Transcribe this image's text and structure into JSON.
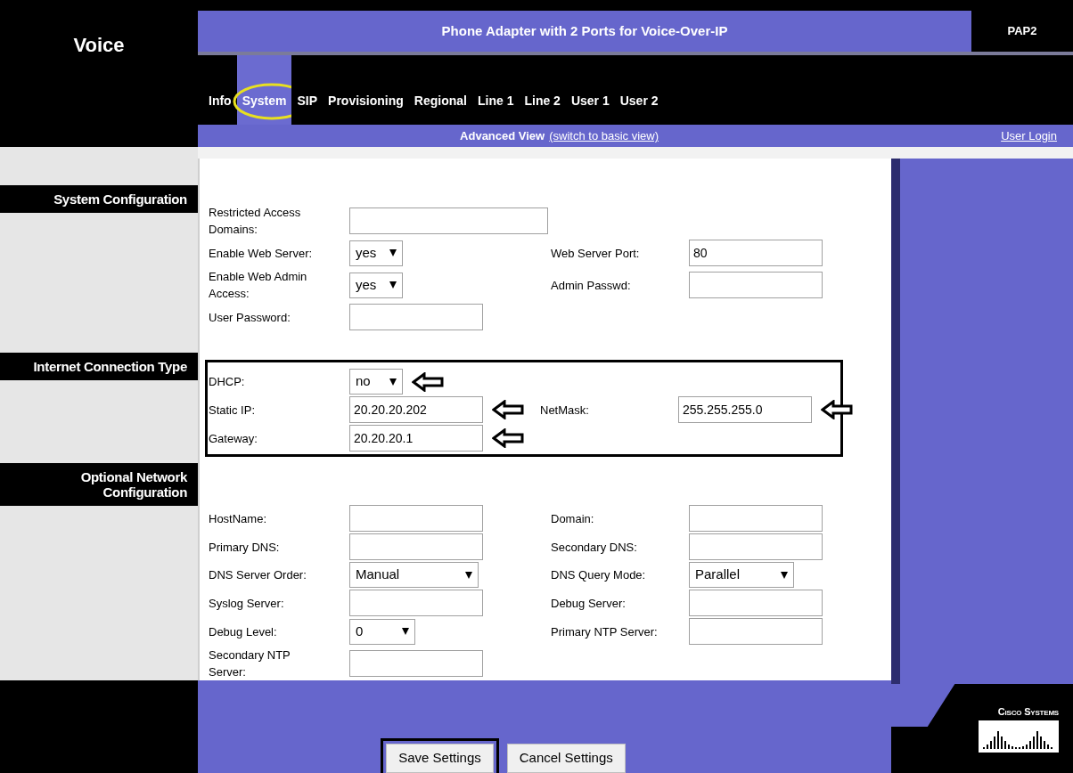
{
  "header": {
    "section": "Voice",
    "title": "Phone Adapter with 2 Ports for Voice-Over-IP",
    "model": "PAP2"
  },
  "tabs": [
    {
      "label": "Info",
      "selected": false,
      "circled": false
    },
    {
      "label": "System",
      "selected": true,
      "circled": true
    },
    {
      "label": "SIP",
      "selected": false,
      "circled": false
    },
    {
      "label": "Provisioning",
      "selected": false,
      "circled": false
    },
    {
      "label": "Regional",
      "selected": false,
      "circled": false
    },
    {
      "label": "Line 1",
      "selected": false,
      "circled": false
    },
    {
      "label": "Line 2",
      "selected": false,
      "circled": false
    },
    {
      "label": "User 1",
      "selected": false,
      "circled": false
    },
    {
      "label": "User 2",
      "selected": false,
      "circled": false
    }
  ],
  "view_bar": {
    "current": "Advanced View",
    "switch_link": "(switch to basic view)",
    "login_link": "User Login"
  },
  "sections": [
    {
      "title": "System Configuration",
      "outlined": false,
      "rows": [
        [
          {
            "label": "Restricted Access Domains:",
            "kind": "wide_text",
            "arrow": false
          }
        ],
        [
          {
            "label": "Enable Web Server:",
            "kind": "select",
            "value": "yes",
            "arrow": false
          },
          {
            "label": "Web Server Port:",
            "kind": "text",
            "value": "80",
            "arrow": false
          }
        ],
        [
          {
            "label": "Enable Web Admin Access:",
            "kind": "select",
            "value": "yes",
            "arrow": false
          },
          {
            "label": "Admin Passwd:",
            "kind": "text",
            "arrow": false
          }
        ],
        [
          {
            "label": "User Password:",
            "kind": "text",
            "arrow": false
          }
        ]
      ]
    },
    {
      "title": "Internet Connection Type",
      "outlined": true,
      "rows": [
        [
          {
            "label": "DHCP:",
            "kind": "select",
            "value": "no",
            "arrow": true
          }
        ],
        [
          {
            "label": "Static IP:",
            "kind": "text",
            "value": "20.20.20.202",
            "arrow": true
          },
          {
            "label": "NetMask:",
            "kind": "text",
            "value": "255.255.255.0",
            "arrow": true
          }
        ],
        [
          {
            "label": "Gateway:",
            "kind": "text",
            "value": "20.20.20.1",
            "arrow": true
          }
        ]
      ]
    },
    {
      "title": "Optional Network Configuration",
      "outlined": false,
      "rows": [
        [
          {
            "label": "HostName:",
            "kind": "text",
            "arrow": false
          },
          {
            "label": "Domain:",
            "kind": "text",
            "arrow": false
          }
        ],
        [
          {
            "label": "Primary DNS:",
            "kind": "text",
            "arrow": false
          },
          {
            "label": "Secondary DNS:",
            "kind": "text",
            "arrow": false
          }
        ],
        [
          {
            "label": "DNS Server Order:",
            "kind": "wide_select",
            "value": "Manual",
            "arrow": false
          },
          {
            "label": "DNS Query Mode:",
            "kind": "mid_select",
            "value": "Parallel",
            "arrow": false
          }
        ],
        [
          {
            "label": "Syslog Server:",
            "kind": "text",
            "arrow": false
          },
          {
            "label": "Debug Server:",
            "kind": "text",
            "arrow": false
          }
        ],
        [
          {
            "label": "Debug Level:",
            "kind": "select",
            "value": "0",
            "arrow": false
          },
          {
            "label": "Primary NTP Server:",
            "kind": "text",
            "arrow": false
          }
        ],
        [
          {
            "label": "Secondary NTP Server:",
            "kind": "text",
            "arrow": false
          }
        ]
      ]
    }
  ],
  "buttons": [
    {
      "label": "Save Settings",
      "outlined": true
    },
    {
      "label": "Cancel Settings",
      "outlined": false
    }
  ],
  "logo": {
    "text": "Cisco Systems"
  }
}
